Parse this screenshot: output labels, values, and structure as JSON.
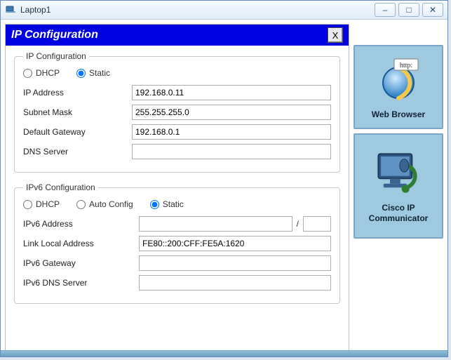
{
  "window": {
    "title": "Laptop1",
    "min_label": "–",
    "max_label": "□",
    "close_label": "✕"
  },
  "header": {
    "title": "IP Configuration",
    "close_label": "X"
  },
  "ip4": {
    "legend": "IP Configuration",
    "dhcp_label": "DHCP",
    "static_label": "Static",
    "mode": "static",
    "fields": {
      "ip_label": "IP Address",
      "ip_value": "192.168.0.11",
      "mask_label": "Subnet Mask",
      "mask_value": "255.255.255.0",
      "gw_label": "Default Gateway",
      "gw_value": "192.168.0.1",
      "dns_label": "DNS Server",
      "dns_value": ""
    }
  },
  "ip6": {
    "legend": "IPv6 Configuration",
    "dhcp_label": "DHCP",
    "auto_label": "Auto Config",
    "static_label": "Static",
    "mode": "static",
    "fields": {
      "addr_label": "IPv6 Address",
      "addr_value": "",
      "prefix_sep": "/",
      "prefix_value": "",
      "ll_label": "Link Local Address",
      "ll_value": "FE80::200:CFF:FE5A:1620",
      "gw_label": "IPv6 Gateway",
      "gw_value": "",
      "dns_label": "IPv6 DNS Server",
      "dns_value": ""
    }
  },
  "desktop": {
    "webbrowser_label": "Web Browser",
    "communicator_label": "Cisco IP Communicator",
    "http_badge": "http:"
  }
}
